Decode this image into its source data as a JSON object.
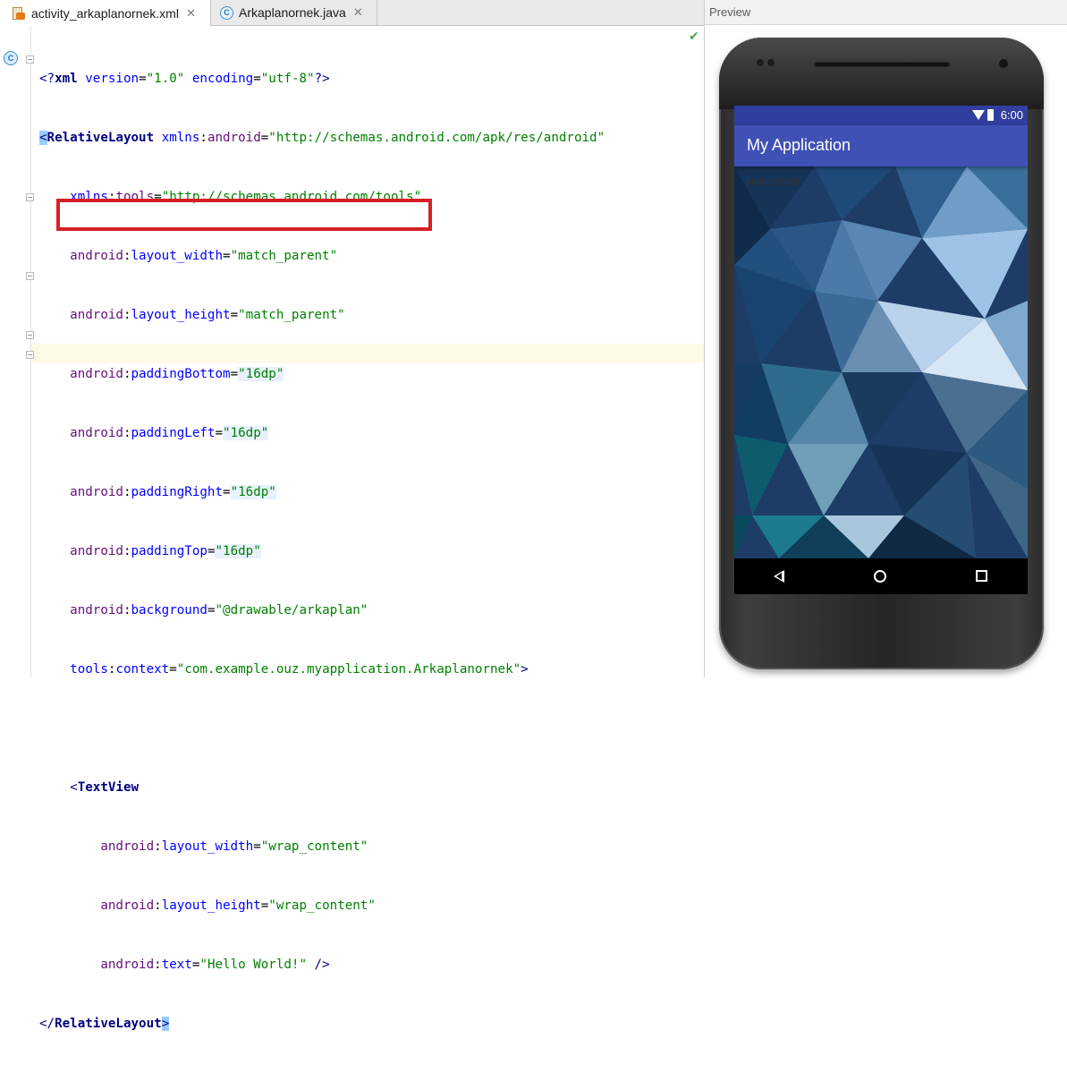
{
  "tabs": [
    {
      "label": "activity_arkaplanornek.xml",
      "close": "✕",
      "icon": "xml-file-icon",
      "active": true
    },
    {
      "label": "Arkaplanornek.java",
      "close": "✕",
      "icon": "java-class-icon",
      "active": false
    }
  ],
  "gutter": {
    "class_marker": "C"
  },
  "code": {
    "l1": {
      "open": "<?",
      "xml": "xml",
      "a1": " version",
      "eq1": "=",
      "v1": "\"1.0\"",
      "a2": " encoding",
      "eq2": "=",
      "v2": "\"utf-8\"",
      "close": "?>"
    },
    "l2": {
      "bracket": "<",
      "tag": "RelativeLayout",
      "sp": " ",
      "ns": "xmlns",
      "colon": ":",
      "attr": "android",
      "eq": "=",
      "val": "\"http://schemas.android.com/apk/res/android\""
    },
    "l3": {
      "ns": "xmlns",
      "colon": ":",
      "attr": "tools",
      "eq": "=",
      "val": "\"http://schemas.android.com/tools\""
    },
    "l4": {
      "ns": "android",
      "colon": ":",
      "attr": "layout_width",
      "eq": "=",
      "val": "\"match_parent\""
    },
    "l5": {
      "ns": "android",
      "colon": ":",
      "attr": "layout_height",
      "eq": "=",
      "val": "\"match_parent\""
    },
    "l6": {
      "ns": "android",
      "colon": ":",
      "attr": "paddingBottom",
      "eq": "=",
      "val": "\"16dp\""
    },
    "l7": {
      "ns": "android",
      "colon": ":",
      "attr": "paddingLeft",
      "eq": "=",
      "val": "\"16dp\""
    },
    "l8": {
      "ns": "android",
      "colon": ":",
      "attr": "paddingRight",
      "eq": "=",
      "val": "\"16dp\""
    },
    "l9": {
      "ns": "android",
      "colon": ":",
      "attr": "paddingTop",
      "eq": "=",
      "val": "\"16dp\""
    },
    "l10": {
      "ns": "android",
      "colon": ":",
      "attr": "background",
      "eq": "=",
      "val": "\"@drawable/arkaplan\""
    },
    "l11": {
      "ns": "tools",
      "colon": ":",
      "attr": "context",
      "eq": "=",
      "val": "\"com.example.ouz.myapplication.Arkaplanornek\"",
      "end": ">"
    },
    "l13": {
      "bracket": "<",
      "tag": "TextView"
    },
    "l14": {
      "ns": "android",
      "colon": ":",
      "attr": "layout_width",
      "eq": "=",
      "val": "\"wrap_content\""
    },
    "l15": {
      "ns": "android",
      "colon": ":",
      "attr": "layout_height",
      "eq": "=",
      "val": "\"wrap_content\""
    },
    "l16": {
      "ns": "android",
      "colon": ":",
      "attr": "text",
      "eq": "=",
      "val": "\"Hello World!\"",
      "end": " />"
    },
    "l17": {
      "open": "</",
      "tag": "RelativeLayout",
      "close": ">"
    }
  },
  "preview": {
    "header": "Preview",
    "status_time": "6:00",
    "app_title": "My Application",
    "hello_text": "Hello World!"
  },
  "colors": {
    "highlight_box": "#d61f26",
    "status_bar": "#303f9f",
    "app_bar": "#3f51b5"
  }
}
